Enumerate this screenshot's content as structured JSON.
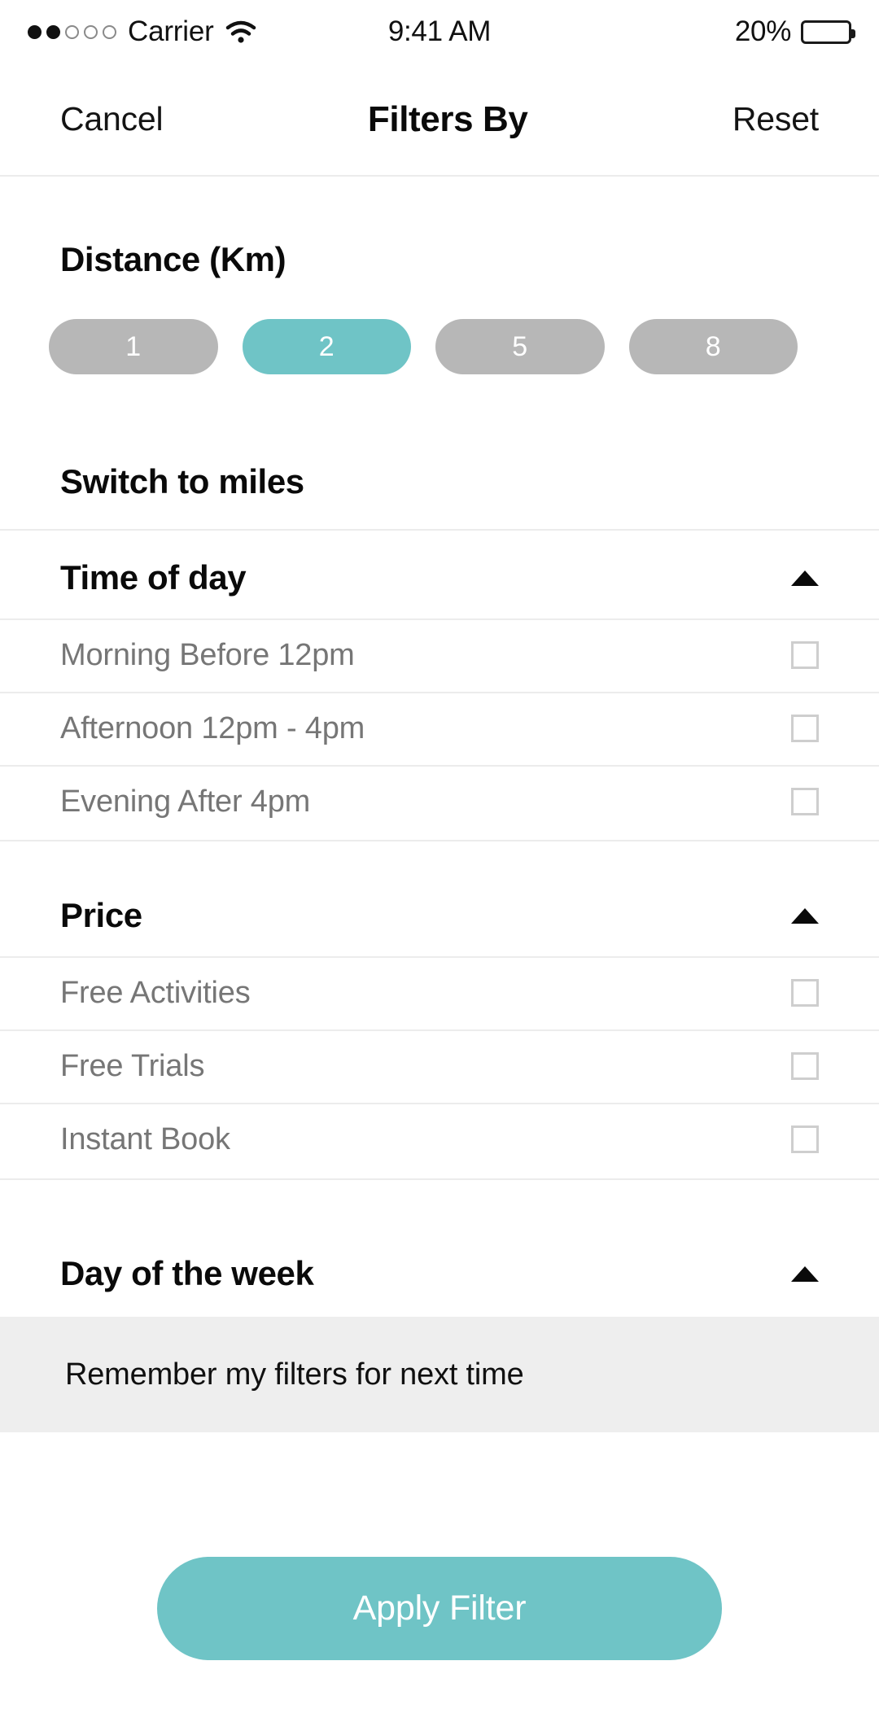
{
  "status_bar": {
    "carrier": "Carrier",
    "signal_dots_total": 5,
    "signal_dots_filled": 2,
    "wifi_icon": "wifi-icon",
    "time": "9:41 AM",
    "battery_percent": "20%",
    "battery_level": 20
  },
  "nav": {
    "cancel_label": "Cancel",
    "title": "Filters By",
    "reset_label": "Reset"
  },
  "distance": {
    "title": "Distance (Km)",
    "options": [
      {
        "label": "1",
        "selected": false
      },
      {
        "label": "2",
        "selected": true
      },
      {
        "label": "5",
        "selected": false
      },
      {
        "label": "8",
        "selected": false
      }
    ],
    "unit_toggle_label": "Switch to miles"
  },
  "sections": [
    {
      "title": "Time of day",
      "expanded": true,
      "caret_icon": "caret-up-icon",
      "options": [
        {
          "label": "Morning Before 12pm",
          "checked": false
        },
        {
          "label": "Afternoon 12pm - 4pm",
          "checked": false
        },
        {
          "label": "Evening After 4pm",
          "checked": false
        }
      ]
    },
    {
      "title": "Price",
      "expanded": true,
      "caret_icon": "caret-up-icon",
      "options": [
        {
          "label": "Free Activities",
          "checked": false
        },
        {
          "label": "Free Trials",
          "checked": false
        },
        {
          "label": "Instant Book",
          "checked": false
        }
      ]
    },
    {
      "title": "Day of the week",
      "expanded": true,
      "caret_icon": "caret-up-icon",
      "options": []
    }
  ],
  "remember": {
    "label": "Remember my filters for next time"
  },
  "footer": {
    "apply_label": "Apply Filter"
  },
  "colors": {
    "accent": "#6FC4C6",
    "pill_inactive": "#B7B7B7",
    "banner_bg": "#EEEEEE",
    "divider": "#ECECEC",
    "option_text": "#767676",
    "checkbox_border": "#CECECE"
  }
}
